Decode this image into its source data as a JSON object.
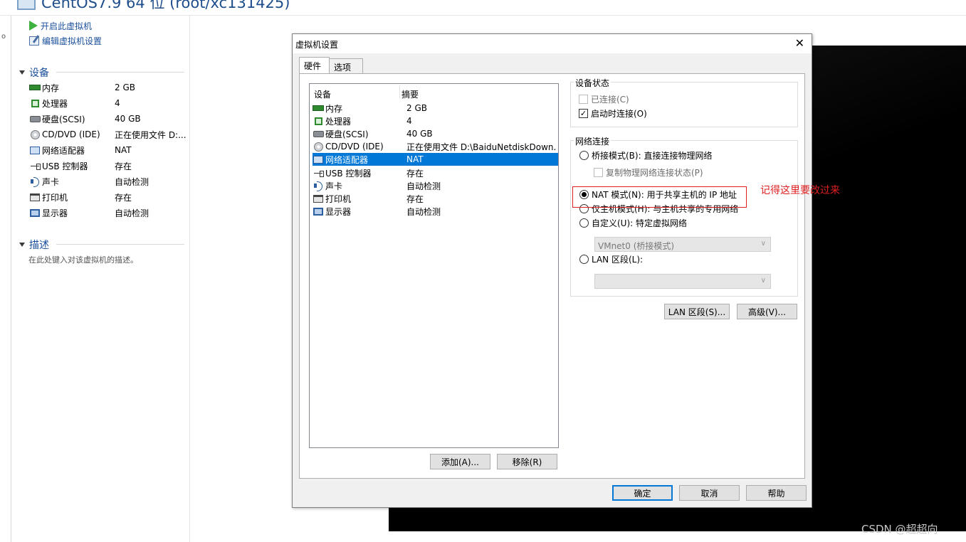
{
  "window_title": "CentOS7.9 64 位 (root/xc131425)",
  "left_edge_mark": "o",
  "sidebar": {
    "actions": [
      "开启此虚拟机",
      "编辑虚拟机设置"
    ],
    "devices_header": "设备",
    "devices": [
      {
        "icon": "memory-icon",
        "name": "内存",
        "value": "2 GB"
      },
      {
        "icon": "processor-icon",
        "name": "处理器",
        "value": "4"
      },
      {
        "icon": "hard-disk-icon",
        "name": "硬盘(SCSI)",
        "value": "40 GB"
      },
      {
        "icon": "cd-dvd-icon",
        "name": "CD/DVD (IDE)",
        "value": "正在使用文件 D:..."
      },
      {
        "icon": "network-adapter-icon",
        "name": "网络适配器",
        "value": "NAT"
      },
      {
        "icon": "usb-icon",
        "name": "USB 控制器",
        "value": "存在"
      },
      {
        "icon": "sound-card-icon",
        "name": "声卡",
        "value": "自动检测"
      },
      {
        "icon": "printer-icon",
        "name": "打印机",
        "value": "存在"
      },
      {
        "icon": "display-icon",
        "name": "显示器",
        "value": "自动检测"
      }
    ],
    "description_header": "描述",
    "description_placeholder": "在此处键入对该虚拟机的描述。"
  },
  "dialog": {
    "title": "虚拟机设置",
    "tabs": [
      "硬件",
      "选项"
    ],
    "list_headers": [
      "设备",
      "摘要"
    ],
    "devices": [
      {
        "icon": "memory-icon",
        "name": "内存",
        "summary": "2 GB"
      },
      {
        "icon": "processor-icon",
        "name": "处理器",
        "summary": "4"
      },
      {
        "icon": "hard-disk-icon",
        "name": "硬盘(SCSI)",
        "summary": "40 GB"
      },
      {
        "icon": "cd-dvd-icon",
        "name": "CD/DVD (IDE)",
        "summary": "正在使用文件 D:\\BaiduNetdiskDown..."
      },
      {
        "icon": "network-adapter-icon",
        "name": "网络适配器",
        "summary": "NAT",
        "selected": true
      },
      {
        "icon": "usb-icon",
        "name": "USB 控制器",
        "summary": "存在"
      },
      {
        "icon": "sound-card-icon",
        "name": "声卡",
        "summary": "自动检测"
      },
      {
        "icon": "printer-icon",
        "name": "打印机",
        "summary": "存在"
      },
      {
        "icon": "display-icon",
        "name": "显示器",
        "summary": "自动检测"
      }
    ],
    "add_button": "添加(A)...",
    "remove_button": "移除(R)",
    "device_status": {
      "label": "设备状态",
      "connected": "已连接(C)",
      "connected_checked": false,
      "connect_on_power": "启动时连接(O)",
      "connect_on_power_checked": true
    },
    "network": {
      "label": "网络连接",
      "bridged": "桥接模式(B): 直接连接物理网络",
      "replicate": "复制物理网络连接状态(P)",
      "nat": "NAT 模式(N): 用于共享主机的 IP 地址",
      "host_only": "仅主机模式(H): 与主机共享的专用网络",
      "custom": "自定义(U): 特定虚拟网络",
      "custom_value": "VMnet0 (桥接模式)",
      "lan_segment": "LAN 区段(L):",
      "lan_value": "",
      "selected": "nat"
    },
    "lan_segments_button": "LAN 区段(S)...",
    "advanced_button": "高级(V)...",
    "ok_button": "确定",
    "cancel_button": "取消",
    "help_button": "帮助"
  },
  "annotation": "记得这里要改过来",
  "watermark": "CSDN @超超向",
  "colors": {
    "selection": "#0078d7",
    "annotation": "#e02020",
    "link": "#1a4f9c"
  }
}
